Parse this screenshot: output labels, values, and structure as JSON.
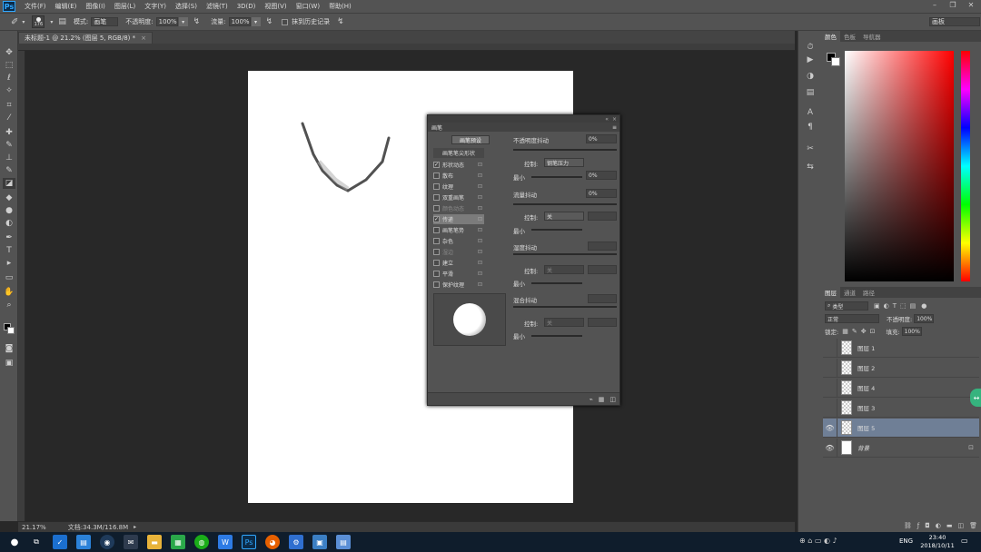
{
  "menubar": {
    "logo": "Ps",
    "items": [
      "文件(F)",
      "编辑(E)",
      "图像(I)",
      "图层(L)",
      "文字(Y)",
      "选择(S)",
      "滤镜(T)",
      "3D(D)",
      "视图(V)",
      "窗口(W)",
      "帮助(H)"
    ]
  },
  "options": {
    "brush_size": "176",
    "mode_label": "模式:",
    "mode_value": "画笔",
    "opacity_label": "不透明度:",
    "opacity_value": "100%",
    "flow_label": "流量:",
    "flow_value": "100%",
    "history_label": "抹到历史记录",
    "workspace": "画板"
  },
  "document": {
    "tab_title": "未标题-1 @ 21.2% (图层 5, RGB/8) *",
    "zoom": "21.17%",
    "doc_size": "文档:34.3M/116.8M"
  },
  "brush_panel": {
    "title": "画笔",
    "preset_button": "画笔预设",
    "tip_shape": "画笔笔尖形状",
    "options": [
      {
        "label": "形状动态",
        "checked": true,
        "enabled": true
      },
      {
        "label": "散布",
        "checked": false,
        "enabled": true
      },
      {
        "label": "纹理",
        "checked": false,
        "enabled": true
      },
      {
        "label": "双重画笔",
        "checked": false,
        "enabled": true
      },
      {
        "label": "颜色动态",
        "checked": false,
        "enabled": false
      },
      {
        "label": "传递",
        "checked": true,
        "enabled": true
      },
      {
        "label": "画笔笔势",
        "checked": false,
        "enabled": true
      },
      {
        "label": "杂色",
        "checked": false,
        "enabled": true
      },
      {
        "label": "湿边",
        "checked": false,
        "enabled": false
      },
      {
        "label": "建立",
        "checked": false,
        "enabled": true
      },
      {
        "label": "平滑",
        "checked": false,
        "enabled": true
      },
      {
        "label": "保护纹理",
        "checked": false,
        "enabled": true
      }
    ],
    "selected_option": "传递",
    "opacity_jitter": "不透明度抖动",
    "opacity_jitter_value": "0%",
    "control_label": "控制:",
    "control_value_1": "钢笔压力",
    "min_label": "最小",
    "min_value_1": "0%",
    "flow_jitter": "流量抖动",
    "flow_jitter_value": "0%",
    "control_value_2": "关",
    "wet_jitter": "湿度抖动",
    "control_value_3": "关",
    "mix_jitter": "混合抖动",
    "control_value_4": "关"
  },
  "color_panel": {
    "tabs": [
      "颜色",
      "色板",
      "导航器"
    ]
  },
  "layers_panel": {
    "tabs": [
      "图层",
      "通道",
      "路径"
    ],
    "filter": "类型",
    "blend_mode": "正常",
    "opacity_label": "不透明度:",
    "opacity_value": "100%",
    "lock_label": "锁定:",
    "fill_label": "填充:",
    "fill_value": "100%",
    "layers": [
      {
        "name": "图层 1",
        "visible": false,
        "selected": false
      },
      {
        "name": "图层 2",
        "visible": false,
        "selected": false
      },
      {
        "name": "图层 4",
        "visible": false,
        "selected": false
      },
      {
        "name": "图层 3",
        "visible": false,
        "selected": false
      },
      {
        "name": "图层 5",
        "visible": true,
        "selected": true
      },
      {
        "name": "背景",
        "visible": true,
        "selected": false
      }
    ]
  },
  "taskbar": {
    "lang": "ENG",
    "time": "23:40",
    "date": "2018/10/11"
  }
}
